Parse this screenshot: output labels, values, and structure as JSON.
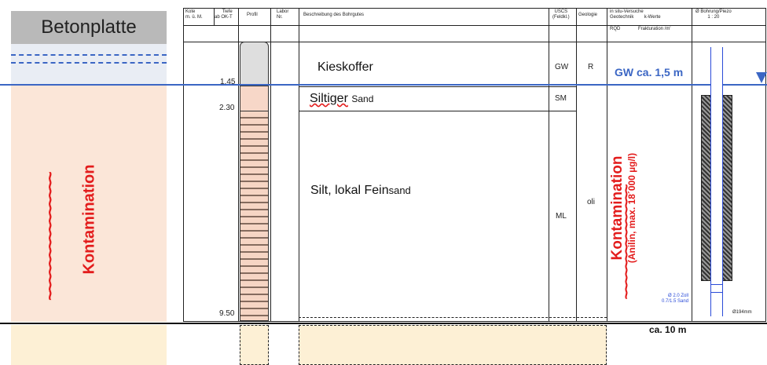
{
  "left_column": {
    "header": "Betonplatte",
    "contamination": "Kontamination",
    "wave": "~~~~~~~~~~~~~~~"
  },
  "log_header": {
    "kote": "Kote\nm. ü. M.",
    "tiefe": "Tiefe\nab OK-T",
    "profil": "Profil",
    "labor": "Labor\nNr.",
    "beschreibung": "Beschreibung des Bohrgutes",
    "uscs": "USCS\n(Feldkl.)",
    "geologie": "Geologie",
    "insitu": "in situ-Versuche\nGeotechnik        k-Werte",
    "rqd": "RQD",
    "fraktur": "Frakturation /m'",
    "bohrung": "Ø Bohrung/Piezo\n1 : 20"
  },
  "depths": {
    "d1": "1.45",
    "d2": "2.30",
    "d3": "9.50"
  },
  "layers": [
    {
      "name": "Kieskoffer",
      "uscs": "GW",
      "geologie": "R"
    },
    {
      "name_main": "Siltiger",
      "name_small": "Sand",
      "uscs": "SM"
    },
    {
      "name_main": "Silt, lokal Fein",
      "name_small": "sand",
      "uscs": "ML",
      "geologie": "oli"
    }
  ],
  "groundwater": "GW ca. 1,5 m",
  "right_contamination": {
    "title": "Kontamination",
    "subtitle": "(Anilin, max. 18´000 µg/l)"
  },
  "piezo_note": {
    "line1": "Ø 2.0 Zoll",
    "line2": "0.7/1.5 Sand",
    "diameter": "Ø194mm"
  },
  "bottom_depth": "ca. 10 m",
  "colors": {
    "contamination": "#e31c1c",
    "water_line": "#3b66c4",
    "groundwater_text": "#3b66c4",
    "concrete": "#b9b9b9",
    "contam_fill": "#fbe6d8"
  }
}
